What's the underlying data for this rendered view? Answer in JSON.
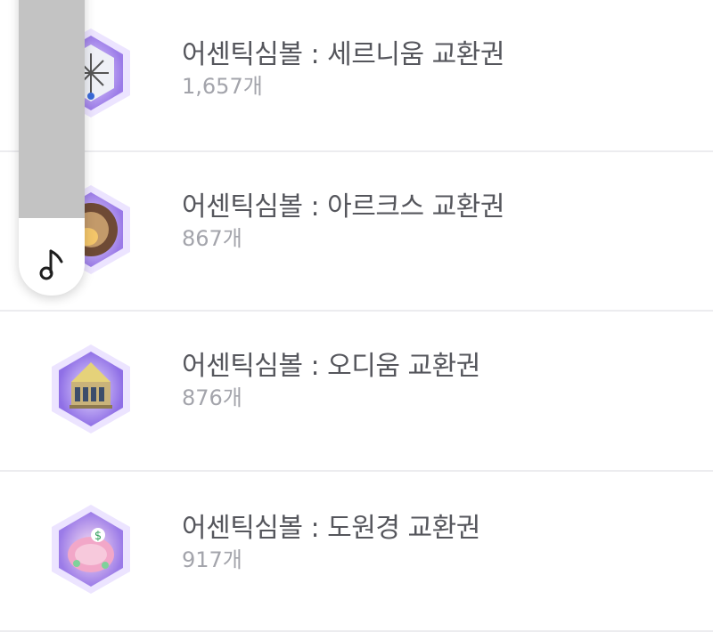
{
  "items": [
    {
      "title": "어센틱심볼 : 세르니움 교환권",
      "count": "1,657개",
      "icon": "cernium-symbol-icon",
      "accent": "#b28cf0"
    },
    {
      "title": "어센틱심볼 : 아르크스 교환권",
      "count": "867개",
      "icon": "arcus-symbol-icon",
      "accent": "#b28cf0"
    },
    {
      "title": "어센틱심볼 : 오디움 교환권",
      "count": "876개",
      "icon": "odium-symbol-icon",
      "accent": "#b28cf0"
    },
    {
      "title": "어센틱심볼 : 도원경 교환권",
      "count": "917개",
      "icon": "shangri-la-symbol-icon",
      "accent": "#b28cf0"
    }
  ],
  "player": {
    "icon": "music-note-icon",
    "bar_color": "#c3c3c3"
  },
  "colors": {
    "title": "#55565c",
    "count": "#a3a4ab",
    "divider": "#ececef"
  }
}
